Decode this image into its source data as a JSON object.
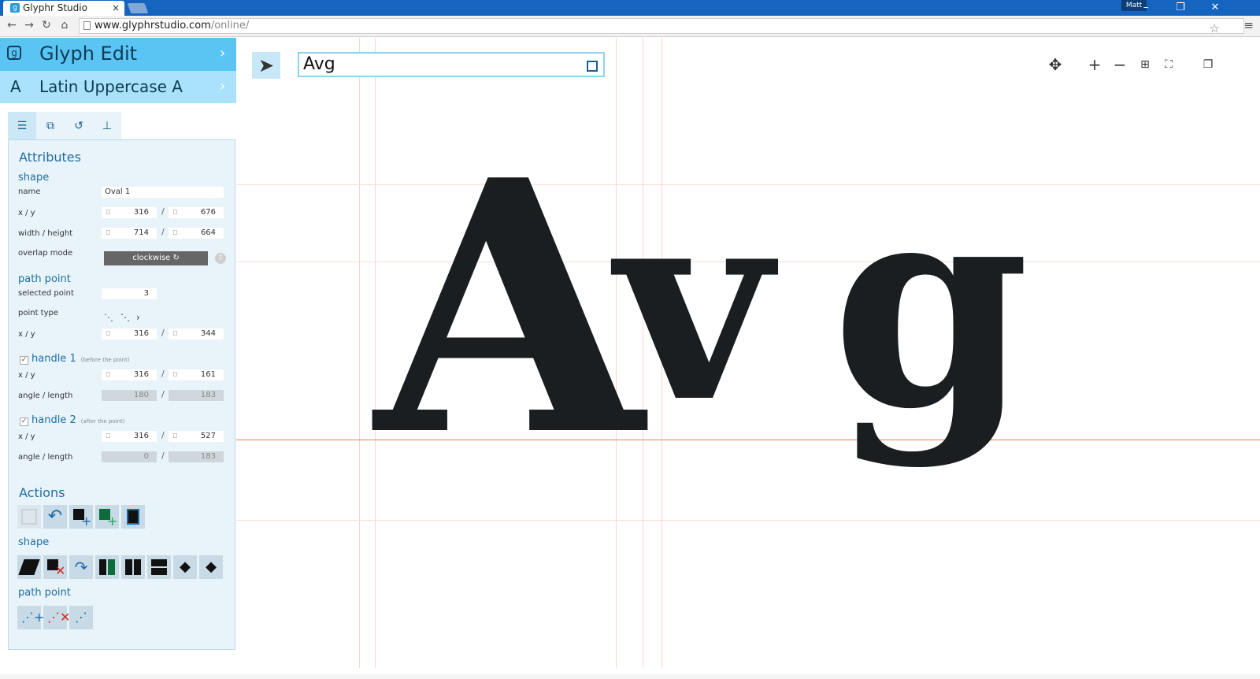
{
  "browser": {
    "tab_title": "Glyphr Studio",
    "tab_close": "×",
    "user_badge": "Matt",
    "url_host": "www.glyphrstudio.com",
    "url_path": "/online/",
    "window_controls": [
      "–",
      "❐",
      "✕"
    ]
  },
  "nav": {
    "page": "Glyph Edit",
    "page_icon": "glyphr-logo-icon",
    "glyph_char": "A",
    "glyph_name": "Latin Uppercase A"
  },
  "panel_tabs": [
    "attributes-tab",
    "layers-tab",
    "history-tab",
    "guides-tab"
  ],
  "attributes": {
    "heading": "Attributes",
    "shape_heading": "shape",
    "name_label": "name",
    "name_value": "Oval 1",
    "xy_label": "x / y",
    "x": "316",
    "y": "676",
    "wh_label": "width / height",
    "width": "714",
    "height": "664",
    "overlap_label": "overlap mode",
    "overlap_value": "clockwise ↻",
    "help": "?",
    "pathpoint_heading": "path point",
    "selected_label": "selected point",
    "selected_value": "3",
    "pointtype_label": "point type",
    "pp_xy_label": "x / y",
    "pp_x": "316",
    "pp_y": "344",
    "handle1_label": "handle 1",
    "handle1_note": "(before the point)",
    "h1_xy_label": "x / y",
    "h1_x": "316",
    "h1_y": "161",
    "h1_al_label": "angle / length",
    "h1_angle": "180",
    "h1_length": "183",
    "handle2_label": "handle 2",
    "handle2_note": "(after the point)",
    "h2_xy_label": "x / y",
    "h2_x": "316",
    "h2_y": "527",
    "h2_al_label": "angle / length",
    "h2_angle": "0",
    "h2_length": "183"
  },
  "actions": {
    "heading": "Actions",
    "shape_heading": "shape",
    "pathpoint_heading": "path point"
  },
  "canvas": {
    "glyph_name_input": "Avg",
    "preview_text": [
      "A",
      "v",
      "g"
    ],
    "colors": {
      "accent": "#5ac4f2",
      "accent_light": "#a9e2fa",
      "glyph": "#1b1e20",
      "baseline": "#f07a55",
      "guide": "#fbd5cf"
    }
  }
}
